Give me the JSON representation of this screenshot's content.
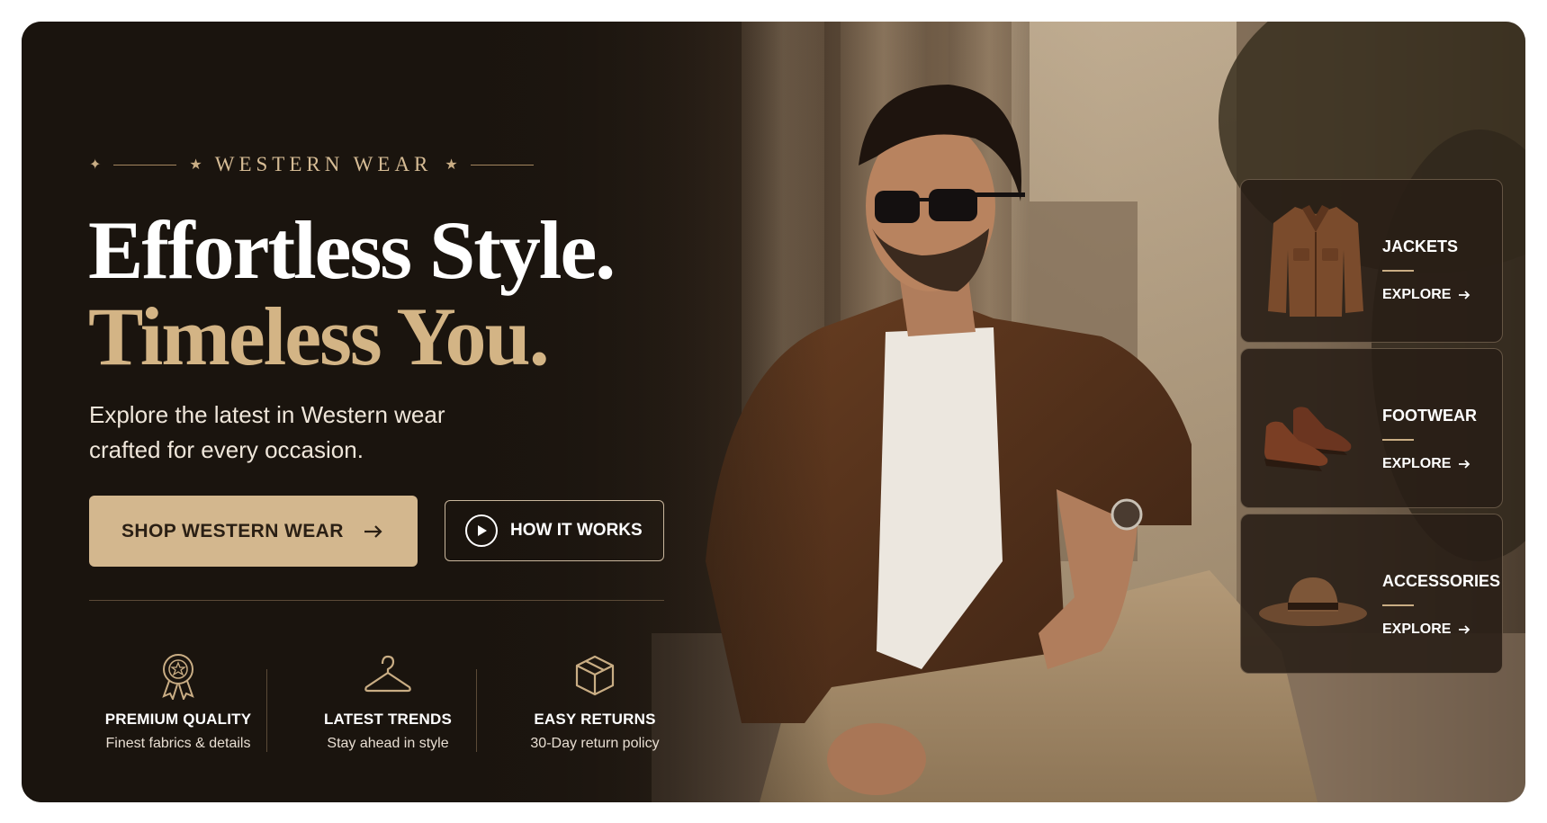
{
  "hero": {
    "overline": "WESTERN WEAR",
    "headline_line1": "Effortless Style.",
    "headline_line2": "Timeless You.",
    "subtitle": "Explore the latest in Western wear crafted for every occasion.",
    "cta_primary": "SHOP WESTERN WEAR",
    "cta_secondary": "HOW IT WORKS"
  },
  "features": [
    {
      "icon": "award-ribbon-icon",
      "title": "PREMIUM QUALITY",
      "subtitle": "Finest fabrics & details"
    },
    {
      "icon": "hanger-icon",
      "title": "LATEST TRENDS",
      "subtitle": "Stay ahead in style"
    },
    {
      "icon": "box-icon",
      "title": "EASY RETURNS",
      "subtitle": "30-Day return policy"
    }
  ],
  "categories": [
    {
      "title": "JACKETS",
      "link": "EXPLORE",
      "icon": "jacket-image"
    },
    {
      "title": "FOOTWEAR",
      "link": "EXPLORE",
      "icon": "shoes-image"
    },
    {
      "title": "ACCESSORIES",
      "link": "EXPLORE",
      "icon": "hat-image"
    }
  ],
  "colors": {
    "background": "#1d1610",
    "accent_gold": "#d3b78e",
    "headline_gold": "#d3b485",
    "text_white": "#ffffff"
  }
}
